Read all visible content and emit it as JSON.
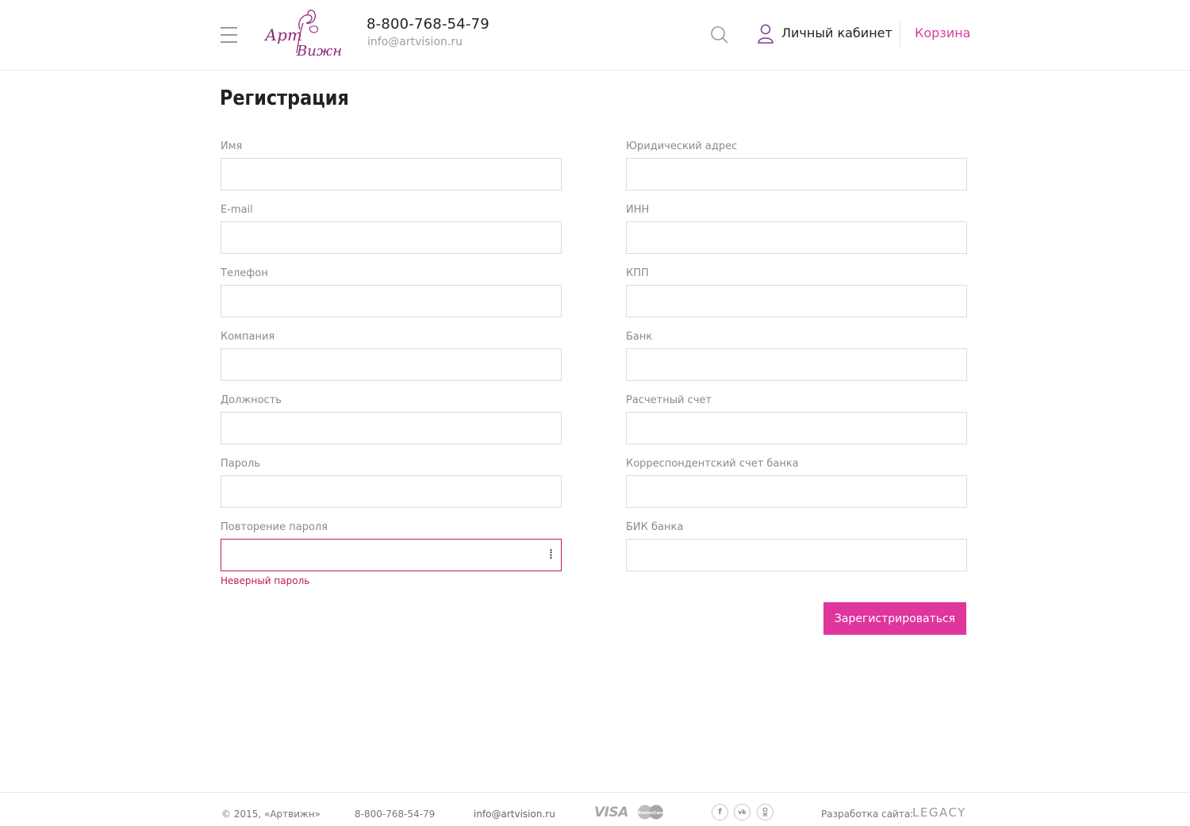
{
  "header": {
    "phone": "8-800-768-54-79",
    "email": "info@artvision.ru",
    "account_label": "Личный кабинет",
    "cart_label": "Корзина",
    "logo_text_1": "Арт",
    "logo_text_2": "Вижн",
    "icons": [
      "menu-icon",
      "search-icon",
      "user-icon"
    ]
  },
  "page_title": "Регистрация",
  "form": {
    "left": [
      {
        "label": "Имя",
        "value": ""
      },
      {
        "label": "E-mail",
        "value": ""
      },
      {
        "label": "Телефон",
        "value": ""
      },
      {
        "label": "Компания",
        "value": ""
      },
      {
        "label": "Должность",
        "value": ""
      },
      {
        "label": "Пароль",
        "value": ""
      },
      {
        "label": "Повторение пароля",
        "value": "",
        "error": "Неверный пароль"
      }
    ],
    "right": [
      {
        "label": "Юридический адрес",
        "value": ""
      },
      {
        "label": "ИНН",
        "value": ""
      },
      {
        "label": "КПП",
        "value": ""
      },
      {
        "label": "Банк",
        "value": ""
      },
      {
        "label": "Расчетный счет",
        "value": ""
      },
      {
        "label": "Корреспондентский счет банка",
        "value": ""
      },
      {
        "label": "БИК банка",
        "value": ""
      }
    ],
    "submit_label": "Зарегистрироваться"
  },
  "footer": {
    "copyright": "© 2015, «Артвижн»",
    "phone": "8-800-768-54-79",
    "email": "info@artvision.ru",
    "payment": [
      "VISA",
      "MasterCard"
    ],
    "social": [
      "f",
      "vk",
      "ok"
    ],
    "dev_label": "Разработка сайта:",
    "dev_name": "LEGACY"
  },
  "colors": {
    "accent": "#e0359d",
    "cart_link": "#d63d9f",
    "error": "#c2185b",
    "logo": "#8e2a7a"
  }
}
